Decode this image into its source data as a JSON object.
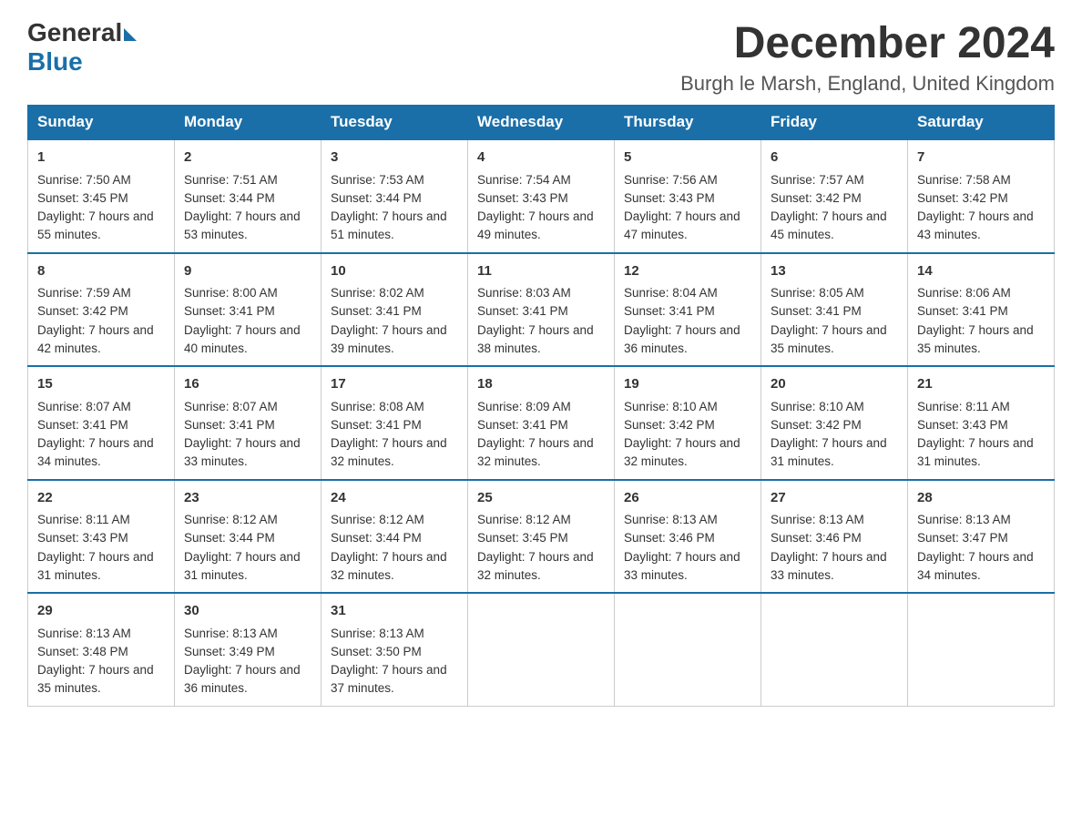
{
  "logo": {
    "general": "General",
    "blue": "Blue"
  },
  "title": "December 2024",
  "location": "Burgh le Marsh, England, United Kingdom",
  "days_of_week": [
    "Sunday",
    "Monday",
    "Tuesday",
    "Wednesday",
    "Thursday",
    "Friday",
    "Saturday"
  ],
  "weeks": [
    [
      {
        "day": "1",
        "sunrise": "7:50 AM",
        "sunset": "3:45 PM",
        "daylight": "7 hours and 55 minutes."
      },
      {
        "day": "2",
        "sunrise": "7:51 AM",
        "sunset": "3:44 PM",
        "daylight": "7 hours and 53 minutes."
      },
      {
        "day": "3",
        "sunrise": "7:53 AM",
        "sunset": "3:44 PM",
        "daylight": "7 hours and 51 minutes."
      },
      {
        "day": "4",
        "sunrise": "7:54 AM",
        "sunset": "3:43 PM",
        "daylight": "7 hours and 49 minutes."
      },
      {
        "day": "5",
        "sunrise": "7:56 AM",
        "sunset": "3:43 PM",
        "daylight": "7 hours and 47 minutes."
      },
      {
        "day": "6",
        "sunrise": "7:57 AM",
        "sunset": "3:42 PM",
        "daylight": "7 hours and 45 minutes."
      },
      {
        "day": "7",
        "sunrise": "7:58 AM",
        "sunset": "3:42 PM",
        "daylight": "7 hours and 43 minutes."
      }
    ],
    [
      {
        "day": "8",
        "sunrise": "7:59 AM",
        "sunset": "3:42 PM",
        "daylight": "7 hours and 42 minutes."
      },
      {
        "day": "9",
        "sunrise": "8:00 AM",
        "sunset": "3:41 PM",
        "daylight": "7 hours and 40 minutes."
      },
      {
        "day": "10",
        "sunrise": "8:02 AM",
        "sunset": "3:41 PM",
        "daylight": "7 hours and 39 minutes."
      },
      {
        "day": "11",
        "sunrise": "8:03 AM",
        "sunset": "3:41 PM",
        "daylight": "7 hours and 38 minutes."
      },
      {
        "day": "12",
        "sunrise": "8:04 AM",
        "sunset": "3:41 PM",
        "daylight": "7 hours and 36 minutes."
      },
      {
        "day": "13",
        "sunrise": "8:05 AM",
        "sunset": "3:41 PM",
        "daylight": "7 hours and 35 minutes."
      },
      {
        "day": "14",
        "sunrise": "8:06 AM",
        "sunset": "3:41 PM",
        "daylight": "7 hours and 35 minutes."
      }
    ],
    [
      {
        "day": "15",
        "sunrise": "8:07 AM",
        "sunset": "3:41 PM",
        "daylight": "7 hours and 34 minutes."
      },
      {
        "day": "16",
        "sunrise": "8:07 AM",
        "sunset": "3:41 PM",
        "daylight": "7 hours and 33 minutes."
      },
      {
        "day": "17",
        "sunrise": "8:08 AM",
        "sunset": "3:41 PM",
        "daylight": "7 hours and 32 minutes."
      },
      {
        "day": "18",
        "sunrise": "8:09 AM",
        "sunset": "3:41 PM",
        "daylight": "7 hours and 32 minutes."
      },
      {
        "day": "19",
        "sunrise": "8:10 AM",
        "sunset": "3:42 PM",
        "daylight": "7 hours and 32 minutes."
      },
      {
        "day": "20",
        "sunrise": "8:10 AM",
        "sunset": "3:42 PM",
        "daylight": "7 hours and 31 minutes."
      },
      {
        "day": "21",
        "sunrise": "8:11 AM",
        "sunset": "3:43 PM",
        "daylight": "7 hours and 31 minutes."
      }
    ],
    [
      {
        "day": "22",
        "sunrise": "8:11 AM",
        "sunset": "3:43 PM",
        "daylight": "7 hours and 31 minutes."
      },
      {
        "day": "23",
        "sunrise": "8:12 AM",
        "sunset": "3:44 PM",
        "daylight": "7 hours and 31 minutes."
      },
      {
        "day": "24",
        "sunrise": "8:12 AM",
        "sunset": "3:44 PM",
        "daylight": "7 hours and 32 minutes."
      },
      {
        "day": "25",
        "sunrise": "8:12 AM",
        "sunset": "3:45 PM",
        "daylight": "7 hours and 32 minutes."
      },
      {
        "day": "26",
        "sunrise": "8:13 AM",
        "sunset": "3:46 PM",
        "daylight": "7 hours and 33 minutes."
      },
      {
        "day": "27",
        "sunrise": "8:13 AM",
        "sunset": "3:46 PM",
        "daylight": "7 hours and 33 minutes."
      },
      {
        "day": "28",
        "sunrise": "8:13 AM",
        "sunset": "3:47 PM",
        "daylight": "7 hours and 34 minutes."
      }
    ],
    [
      {
        "day": "29",
        "sunrise": "8:13 AM",
        "sunset": "3:48 PM",
        "daylight": "7 hours and 35 minutes."
      },
      {
        "day": "30",
        "sunrise": "8:13 AM",
        "sunset": "3:49 PM",
        "daylight": "7 hours and 36 minutes."
      },
      {
        "day": "31",
        "sunrise": "8:13 AM",
        "sunset": "3:50 PM",
        "daylight": "7 hours and 37 minutes."
      },
      null,
      null,
      null,
      null
    ]
  ]
}
